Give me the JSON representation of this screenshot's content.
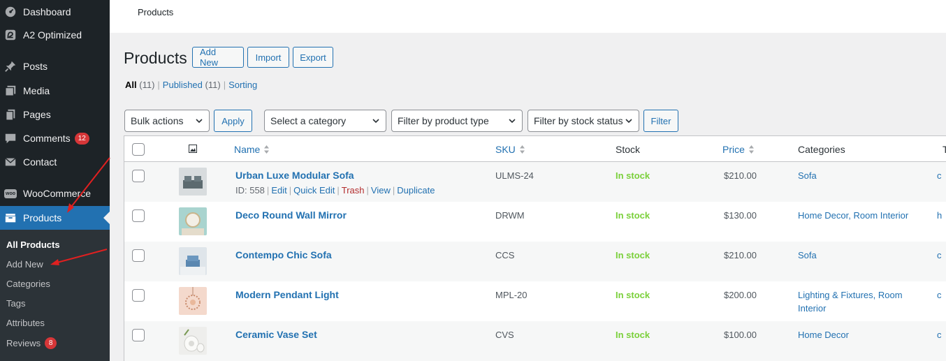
{
  "sidebar": {
    "items": [
      {
        "label": "Dashboard",
        "icon": "dashboard-icon"
      },
      {
        "label": "A2 Optimized",
        "icon": "a2-icon"
      },
      {
        "label": "Posts",
        "icon": "pin-icon"
      },
      {
        "label": "Media",
        "icon": "media-icon"
      },
      {
        "label": "Pages",
        "icon": "pages-icon"
      },
      {
        "label": "Comments",
        "icon": "comment-icon",
        "badge": "12"
      },
      {
        "label": "Contact",
        "icon": "mail-icon"
      },
      {
        "label": "WooCommerce",
        "icon": "woo-icon",
        "icon_text": "woo"
      },
      {
        "label": "Products",
        "icon": "archive-icon",
        "active": true
      }
    ],
    "submenu": [
      {
        "label": "All Products",
        "current": true
      },
      {
        "label": "Add New"
      },
      {
        "label": "Categories"
      },
      {
        "label": "Tags"
      },
      {
        "label": "Attributes"
      },
      {
        "label": "Reviews",
        "badge": "8"
      }
    ],
    "colors": {
      "bg": "#1d2327",
      "active": "#2271b1",
      "sub_bg": "#2c3338"
    }
  },
  "topbar": {
    "title": "Products"
  },
  "header": {
    "title": "Products",
    "buttons": [
      "Add New",
      "Import",
      "Export"
    ]
  },
  "views": {
    "all_label": "All",
    "all_count": "(11)",
    "published_label": "Published",
    "published_count": "(11)",
    "sorting_label": "Sorting",
    "sep": "|"
  },
  "filters": {
    "bulk_actions": "Bulk actions",
    "apply": "Apply",
    "category": "Select a category",
    "product_type": "Filter by product type",
    "stock_status": "Filter by stock status",
    "filter": "Filter"
  },
  "table": {
    "columns": {
      "name": "Name",
      "sku": "SKU",
      "stock": "Stock",
      "price": "Price",
      "categories": "Categories",
      "tags_partial": "T"
    },
    "rows": [
      {
        "name": "Urban Luxe Modular Sofa",
        "sku": "ULMS-24",
        "stock": "In stock",
        "price": "$210.00",
        "categories": "Sofa",
        "tags_partial": "c",
        "actions": {
          "id": "ID: 558",
          "edit": "Edit",
          "quick_edit": "Quick Edit",
          "trash": "Trash",
          "view": "View",
          "duplicate": "Duplicate"
        }
      },
      {
        "name": "Deco Round Wall Mirror",
        "sku": "DRWM",
        "stock": "In stock",
        "price": "$130.00",
        "categories": "Home Decor, Room Interior",
        "tags_partial": "h"
      },
      {
        "name": "Contempo Chic Sofa",
        "sku": "CCS",
        "stock": "In stock",
        "price": "$210.00",
        "categories": "Sofa",
        "tags_partial": "c"
      },
      {
        "name": "Modern Pendant Light",
        "sku": "MPL-20",
        "stock": "In stock",
        "price": "$200.00",
        "categories": "Lighting & Fixtures, Room Interior",
        "tags_partial": "c"
      },
      {
        "name": "Ceramic Vase Set",
        "sku": "CVS",
        "stock": "In stock",
        "price": "$100.00",
        "categories": "Home Decor",
        "tags_partial": "c"
      }
    ],
    "colors": {
      "link": "#2271b1",
      "in_stock": "#7ad03a",
      "trash": "#b32d2e"
    }
  },
  "annotation_color": "#e02020"
}
